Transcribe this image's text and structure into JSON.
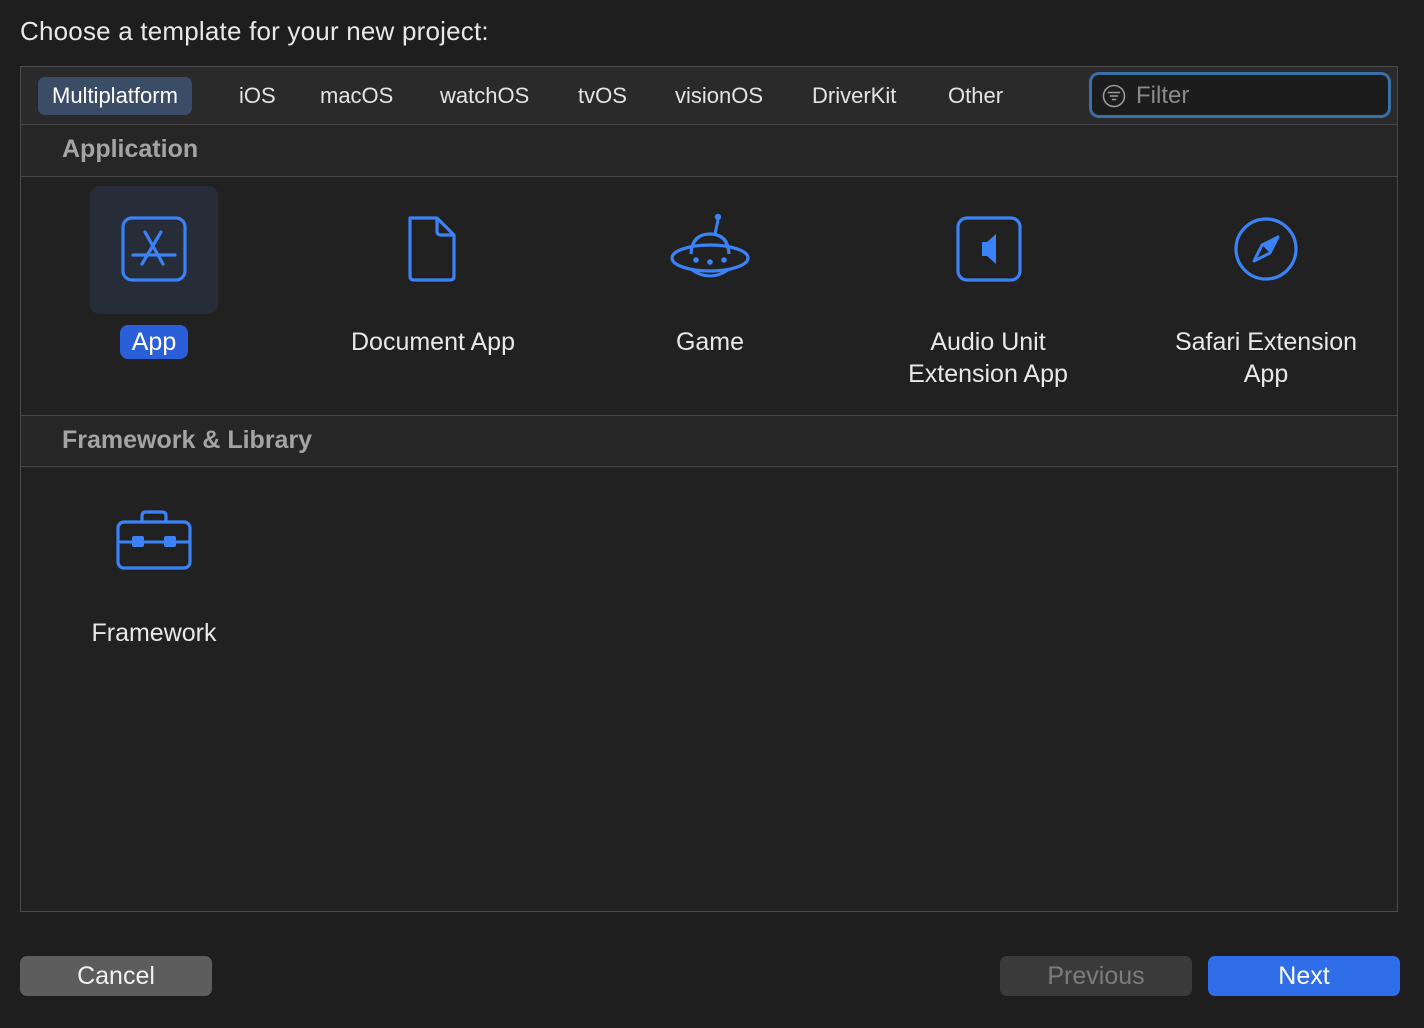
{
  "prompt": "Choose a template for your new project:",
  "tabs": [
    {
      "label": "Multiplatform",
      "active": true
    },
    {
      "label": "iOS"
    },
    {
      "label": "macOS"
    },
    {
      "label": "watchOS"
    },
    {
      "label": "tvOS"
    },
    {
      "label": "visionOS"
    },
    {
      "label": "DriverKit"
    },
    {
      "label": "Other"
    }
  ],
  "filter": {
    "placeholder": "Filter",
    "value": ""
  },
  "sections": [
    {
      "title": "Application",
      "templates": [
        {
          "label": "App",
          "icon": "app-store-icon",
          "selected": true
        },
        {
          "label": "Document App",
          "icon": "document-icon"
        },
        {
          "label": "Game",
          "icon": "ufo-icon"
        },
        {
          "label_line1": "Audio Unit",
          "label_line2": "Extension App",
          "icon": "speaker-icon"
        },
        {
          "label_line1": "Safari Extension",
          "label_line2": "App",
          "icon": "compass-icon"
        }
      ]
    },
    {
      "title": "Framework & Library",
      "templates": [
        {
          "label": "Framework",
          "icon": "toolbox-icon"
        }
      ]
    }
  ],
  "buttons": {
    "cancel": "Cancel",
    "previous": "Previous",
    "next": "Next"
  },
  "colors": {
    "accent": "#2f6ee8",
    "icon_blue": "#3b82f6",
    "background": "#1e1e1e"
  }
}
